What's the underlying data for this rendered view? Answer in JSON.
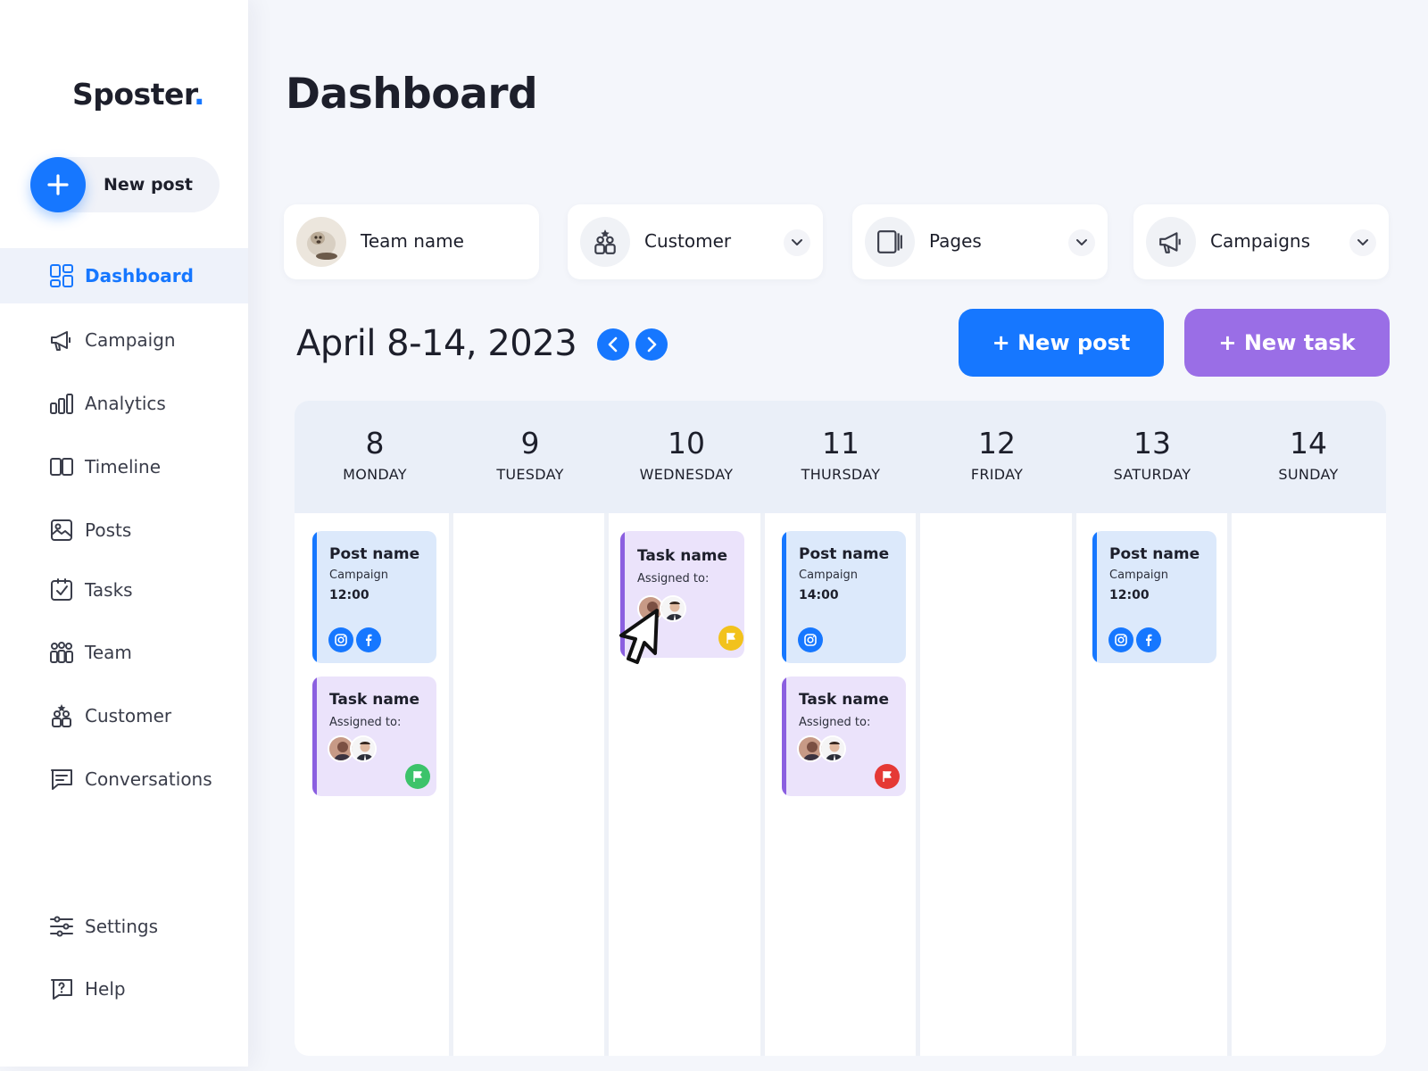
{
  "app": {
    "logo_text": "Sposter",
    "logo_dot": ".",
    "accent": "#1677ff",
    "purple": "#9a6ee6"
  },
  "sidebar": {
    "new_post_label": "New post",
    "items": [
      {
        "label": "Dashboard",
        "icon": "dashboard-icon",
        "active": true
      },
      {
        "label": "Campaign",
        "icon": "megaphone-icon"
      },
      {
        "label": "Analytics",
        "icon": "bar-chart-icon"
      },
      {
        "label": "Timeline",
        "icon": "timeline-icon"
      },
      {
        "label": "Posts",
        "icon": "image-icon"
      },
      {
        "label": "Tasks",
        "icon": "checkbox-icon"
      },
      {
        "label": "Team",
        "icon": "team-icon"
      },
      {
        "label": "Customer",
        "icon": "customer-icon"
      },
      {
        "label": "Conversations",
        "icon": "chat-icon"
      }
    ],
    "bottom": [
      {
        "label": "Settings",
        "icon": "sliders-icon"
      },
      {
        "label": "Help",
        "icon": "help-icon"
      }
    ]
  },
  "header": {
    "title": "Dashboard"
  },
  "filters": [
    {
      "label": "Team name",
      "icon": "team-avatar"
    },
    {
      "label": "Customer",
      "icon": "customer-icon"
    },
    {
      "label": "Pages",
      "icon": "pages-icon"
    },
    {
      "label": "Campaigns",
      "icon": "megaphone-icon"
    }
  ],
  "calendar": {
    "range_label": "April 8-14, 2023",
    "new_post_button": "+ New post",
    "new_task_button": "+ New task",
    "days": [
      {
        "num": "8",
        "name": "MONDAY"
      },
      {
        "num": "9",
        "name": "TUESDAY"
      },
      {
        "num": "10",
        "name": "WEDNESDAY"
      },
      {
        "num": "11",
        "name": "THURSDAY"
      },
      {
        "num": "12",
        "name": "FRIDAY"
      },
      {
        "num": "13",
        "name": "SATURDAY"
      },
      {
        "num": "14",
        "name": "SUNDAY"
      }
    ],
    "cards": {
      "mon_post": {
        "title": "Post name",
        "sub": "Campaign",
        "time": "12:00",
        "socials": [
          "instagram-icon",
          "facebook-icon"
        ]
      },
      "mon_task": {
        "title": "Task name",
        "sub": "Assigned to:",
        "flag_color": "#3cc36a"
      },
      "wed_task": {
        "title": "Task name",
        "sub": "Assigned to:",
        "flag_color": "#f2c21c"
      },
      "thu_post": {
        "title": "Post name",
        "sub": "Campaign",
        "time": "14:00",
        "socials": [
          "instagram-icon"
        ]
      },
      "thu_task": {
        "title": "Task name",
        "sub": "Assigned to:",
        "flag_color": "#e53935"
      },
      "sat_post": {
        "title": "Post name",
        "sub": "Campaign",
        "time": "12:00",
        "socials": [
          "instagram-icon",
          "facebook-icon"
        ]
      }
    }
  }
}
